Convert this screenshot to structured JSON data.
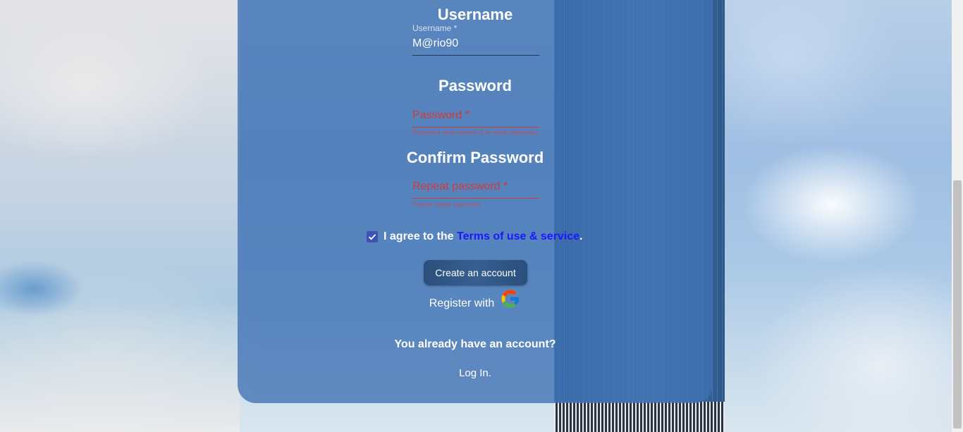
{
  "form": {
    "username_heading": "Username",
    "username_label": "Username *",
    "username_value": "M@rio90",
    "password_heading": "Password",
    "password_placeholder": "Password *",
    "password_helper": "Password must contain 8 or more characters",
    "confirm_heading": "Confirm Password",
    "confirm_placeholder": "Repeat password *",
    "confirm_helper": "Please repeat password",
    "agree_prefix": "I agree to the ",
    "terms_link": "Terms of use & service",
    "agree_suffix": ".",
    "agree_checked": true,
    "create_button": "Create an account",
    "register_with": "Register with",
    "already_text": "You already have an account?",
    "login_link": "Log In."
  },
  "icons": {
    "checkbox": "check-icon",
    "google": "google-icon"
  },
  "colors": {
    "card": "#3f71b2",
    "error": "#d23a3a",
    "link": "#1a1aff",
    "checkbox": "#3f51b5",
    "button": "#2b4f7c"
  }
}
